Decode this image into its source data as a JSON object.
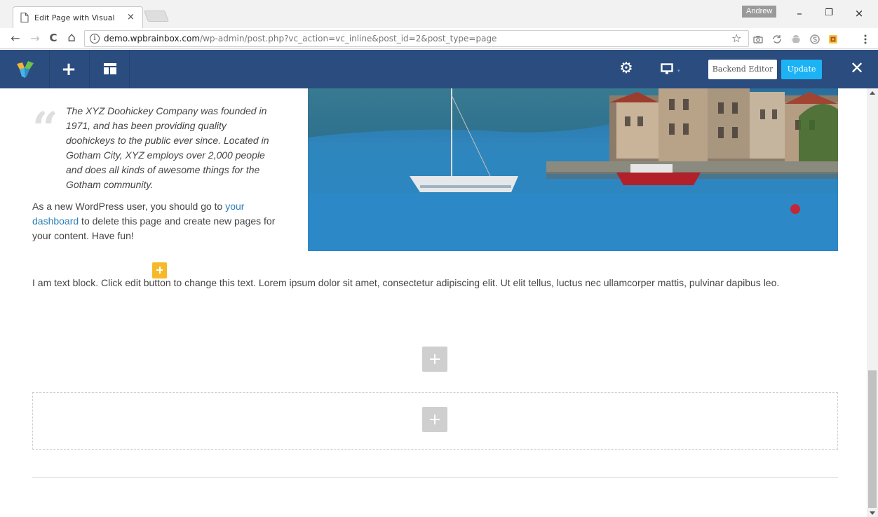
{
  "browser": {
    "tab_title": "Edit Page with Visual Con",
    "tab_close": "×",
    "profile_name": "Andrew",
    "window_minimize": "–",
    "window_restore": "❐",
    "window_close": "×",
    "nav_back": "←",
    "nav_forward": "→",
    "nav_reload": "C",
    "nav_home": "⌂",
    "info_glyph": "i",
    "url_host": "demo.wpbrainbox.com",
    "url_path": "/wp-admin/post.php?vc_action=vc_inline&post_id=2&post_type=page",
    "bookmark_glyph": "☆",
    "extensions": [
      "camera-icon",
      "sync-icon",
      "android-icon",
      "skype-icon",
      "extension-icon",
      "menu-icon"
    ]
  },
  "toolbar": {
    "background": "#2b4c7e",
    "add_glyph": "+",
    "settings_glyph": "⚙",
    "device_glyph": "🖵",
    "device_arrow_glyph": "▾",
    "backend_label": "Backend Editor",
    "update_label": "Update",
    "update_color": "#1cb3f5",
    "close_glyph": "✕"
  },
  "content": {
    "quote_mark": "“",
    "quote": "The XYZ Doohickey Company was founded in 1971, and has been providing quality doohickeys to the public ever since. Located in Gotham City, XYZ employs over 2,000 people and does all kinds of awesome things for the Gotham community.",
    "paragraph_before": "As a new WordPress user, you should go to ",
    "paragraph_link": "your dashboard",
    "paragraph_after": " to delete this page and create new pages for your content. Have fun!",
    "text_block": "I am text block. Click edit button to change this text. Lorem ipsum dolor sit amet, consectetur adipiscing elit. Ut elit tellus, luctus nec ullamcorper mattis, pulvinar dapibus leo.",
    "link_color": "#2a7fb8",
    "edit_badge_color": "#f6b929"
  }
}
